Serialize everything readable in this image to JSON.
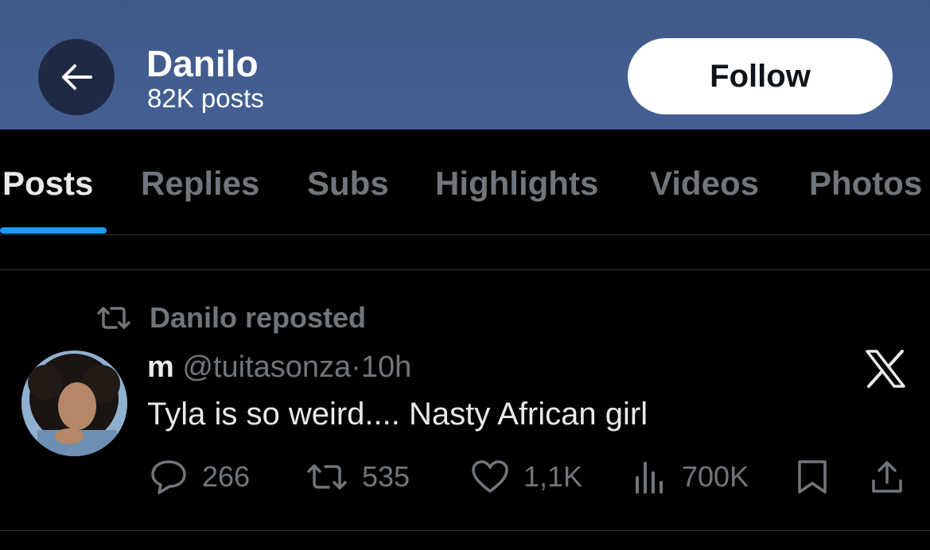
{
  "header": {
    "title": "Danilo",
    "subtitle": "82K posts",
    "follow_label": "Follow",
    "back_icon": "arrow-left-icon"
  },
  "tabs": [
    {
      "label": "Posts",
      "active": true
    },
    {
      "label": "Replies",
      "active": false
    },
    {
      "label": "Subs",
      "active": false
    },
    {
      "label": "Highlights",
      "active": false
    },
    {
      "label": "Videos",
      "active": false
    },
    {
      "label": "Photos",
      "active": false
    }
  ],
  "post": {
    "repost_label": "Danilo reposted",
    "author_name": "m",
    "author_handle": "@tuitasonza",
    "separator": "·",
    "time": "10h",
    "text": "Tyla is so weird.... Nasty African girl",
    "actions": {
      "replies": "266",
      "reposts": "535",
      "likes": "1,1K",
      "views": "700K"
    }
  },
  "colors": {
    "header_bg": "#445f93",
    "accent": "#1d9bf0",
    "muted_text": "#71767b",
    "primary_text": "#e7e9ea"
  }
}
